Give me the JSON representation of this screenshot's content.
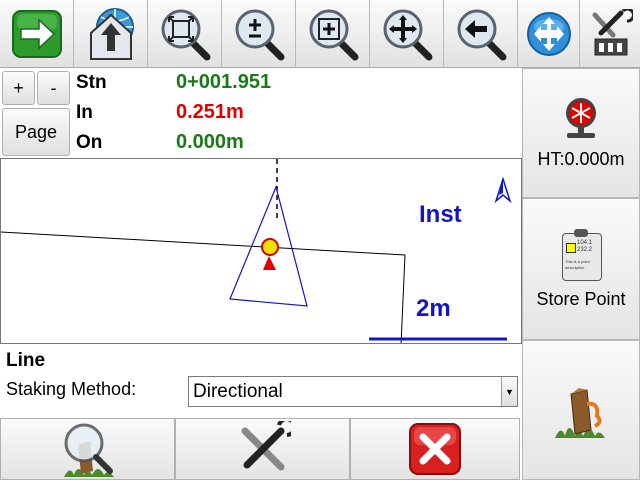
{
  "toolbar": {
    "buttons": [
      {
        "name": "next-arrow-icon"
      },
      {
        "name": "north-up-icon"
      },
      {
        "name": "zoom-extents-icon"
      },
      {
        "name": "zoom-in-out-icon"
      },
      {
        "name": "zoom-window-icon"
      },
      {
        "name": "pan-icon"
      },
      {
        "name": "zoom-previous-icon"
      },
      {
        "name": "gnss-icon"
      },
      {
        "name": "settings-tools-icon"
      }
    ]
  },
  "page_controls": {
    "plus": "+",
    "minus": "-",
    "page": "Page"
  },
  "info": {
    "rows": [
      {
        "label": "Stn",
        "value": "0+001.951",
        "color": "#1a7a1a"
      },
      {
        "label": "In",
        "value": "0.251m",
        "color": "#e00000"
      },
      {
        "label": "On",
        "value": "0.000m",
        "color": "#1a7a1a"
      }
    ]
  },
  "map": {
    "mode_label": "Inst",
    "scale_label": "2m",
    "accent": "#1414c8",
    "target_color": "#e00000",
    "prism_color": "#f2e000"
  },
  "right_panel": {
    "ht_label": "HT:0.000m",
    "store_label": "Store Point",
    "note_lines": [
      "104.1",
      "232.2",
      "This is a point",
      "description"
    ]
  },
  "staking": {
    "title": "Line",
    "method_label": "Staking Method:",
    "method_value": "Directional"
  },
  "bottom": {
    "buttons": [
      {
        "name": "survey-stake-icon"
      },
      {
        "name": "options-tools-icon"
      },
      {
        "name": "close-icon"
      }
    ]
  }
}
